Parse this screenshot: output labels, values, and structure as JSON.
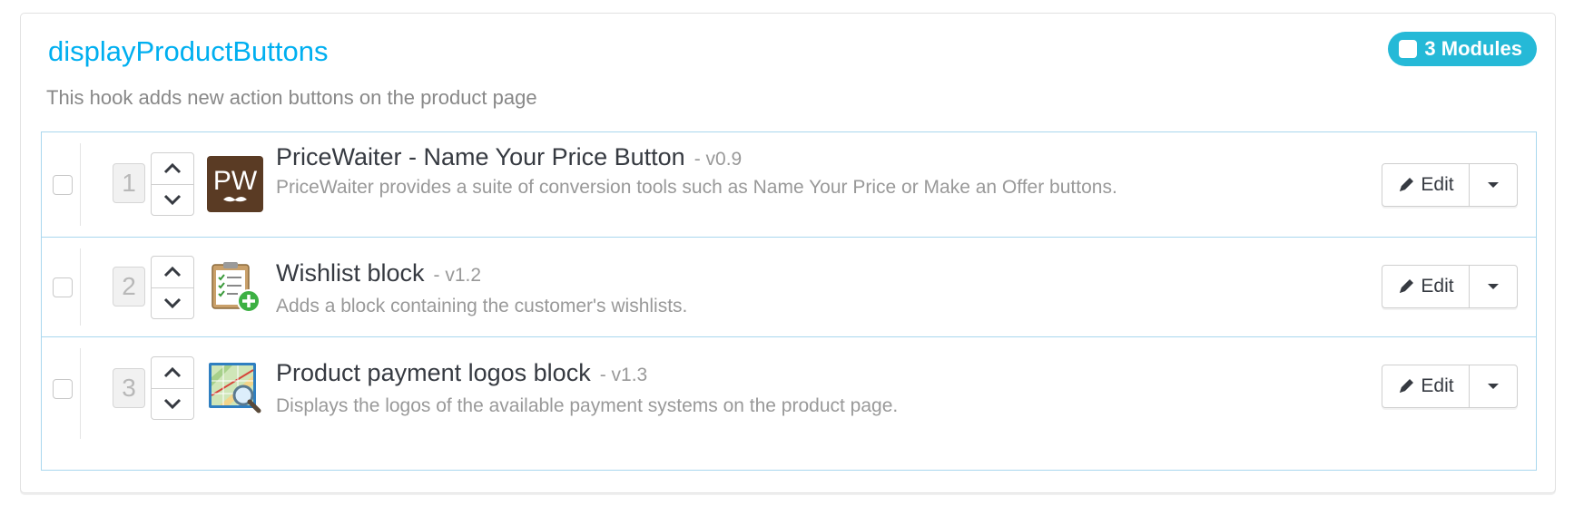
{
  "hook": {
    "title": "displayProductButtons",
    "description": "This hook adds new action buttons on the product page",
    "modules_badge": "3 Modules"
  },
  "modules": [
    {
      "position": "1",
      "name": "PriceWaiter - Name Your Price Button",
      "version": "- v0.9",
      "description": "PriceWaiter provides a suite of conversion tools such as Name Your Price or Make an Offer buttons.",
      "icon": "pricewaiter-logo-icon",
      "icon_text": "PW",
      "edit_label": "Edit"
    },
    {
      "position": "2",
      "name": "Wishlist block",
      "version": "- v1.2",
      "description": "Adds a block containing the customer's wishlists.",
      "icon": "wishlist-clipboard-icon",
      "edit_label": "Edit"
    },
    {
      "position": "3",
      "name": "Product payment logos block",
      "version": "- v1.3",
      "description": "Displays the logos of the available payment systems on the product page.",
      "icon": "payment-logos-map-icon",
      "edit_label": "Edit"
    }
  ],
  "colors": {
    "accent": "#00aff0",
    "badge": "#25b9d7",
    "row_border": "#a9d7ee"
  }
}
